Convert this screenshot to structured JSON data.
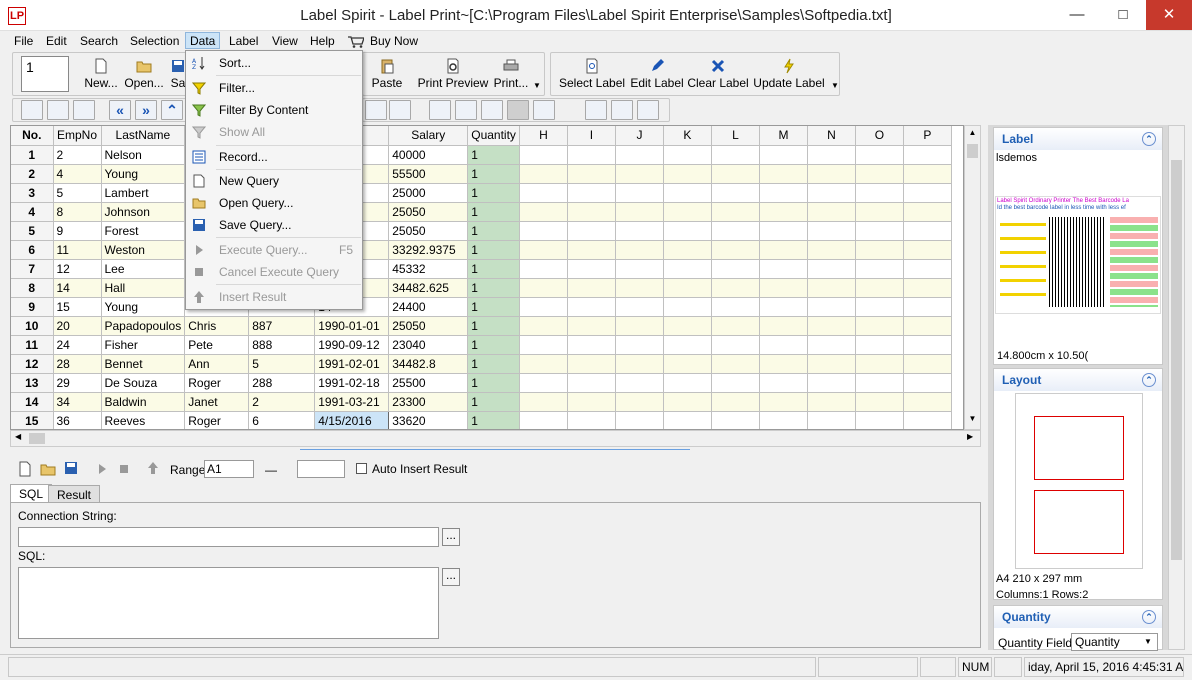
{
  "window": {
    "title": "Label Spirit - Label Print~[C:\\Program Files\\Label Spirit Enterprise\\Samples\\Softpedia.txt]",
    "icon_text": "LP"
  },
  "menu": [
    "File",
    "Edit",
    "Search",
    "Selection",
    "Data",
    "Label",
    "View",
    "Help",
    "Buy Now"
  ],
  "toolbar1": {
    "number_field": "1",
    "buttons": [
      "New...",
      "Open...",
      "Sa",
      "Paste",
      "Print Preview",
      "Print...",
      "Select Label",
      "Edit Label",
      "Clear Label",
      "Update Label"
    ]
  },
  "data_menu": {
    "items": [
      {
        "label": "Sort...",
        "enabled": true
      },
      {
        "label": "Filter...",
        "enabled": true
      },
      {
        "label": "Filter By Content",
        "enabled": true
      },
      {
        "label": "Show All",
        "enabled": false
      },
      {
        "label": "Record...",
        "enabled": true
      },
      {
        "label": "New Query",
        "enabled": true
      },
      {
        "label": "Open Query...",
        "enabled": true
      },
      {
        "label": "Save Query...",
        "enabled": true
      },
      {
        "label": "Execute Query...",
        "enabled": false,
        "shortcut": "F5"
      },
      {
        "label": "Cancel Execute Query",
        "enabled": false
      },
      {
        "label": "Insert Result",
        "enabled": false
      }
    ]
  },
  "grid": {
    "headers": [
      "No.",
      "EmpNo",
      "LastName",
      "",
      "",
      "e",
      "Salary",
      "Quantity",
      "H",
      "I",
      "J",
      "K",
      "L",
      "M",
      "N",
      "O",
      "P"
    ],
    "rows": [
      [
        "1",
        "2",
        "Nelson",
        "",
        "",
        "28",
        "40000",
        "1"
      ],
      [
        "2",
        "4",
        "Young",
        "",
        "",
        "28",
        "55500",
        "1"
      ],
      [
        "3",
        "5",
        "Lambert",
        "",
        "",
        "06",
        "25000",
        "1"
      ],
      [
        "4",
        "8",
        "Johnson",
        "",
        "",
        "05",
        "25050",
        "1"
      ],
      [
        "5",
        "9",
        "Forest",
        "",
        "",
        "17",
        "25050",
        "1"
      ],
      [
        "6",
        "11",
        "Weston",
        "",
        "",
        "17",
        "33292.9375",
        "1"
      ],
      [
        "7",
        "12",
        "Lee",
        "",
        "",
        "01",
        "45332",
        "1"
      ],
      [
        "8",
        "14",
        "Hall",
        "",
        "",
        "04",
        "34482.625",
        "1"
      ],
      [
        "9",
        "15",
        "Young",
        "",
        "",
        "14",
        "24400",
        "1"
      ],
      [
        "10",
        "20",
        "Papadopoulos",
        "Chris",
        "887",
        "1990-01-01",
        "25050",
        "1"
      ],
      [
        "11",
        "24",
        "Fisher",
        "Pete",
        "888",
        "1990-09-12",
        "23040",
        "1"
      ],
      [
        "12",
        "28",
        "Bennet",
        "Ann",
        "5",
        "1991-02-01",
        "34482.8",
        "1"
      ],
      [
        "13",
        "29",
        "De Souza",
        "Roger",
        "288",
        "1991-02-18",
        "25500",
        "1"
      ],
      [
        "14",
        "34",
        "Baldwin",
        "Janet",
        "2",
        "1991-03-21",
        "23300",
        "1"
      ],
      [
        "15",
        "36",
        "Reeves",
        "Roger",
        "6",
        "4/15/2016",
        "33620",
        "1"
      ]
    ]
  },
  "sql": {
    "range_label": "Range:",
    "range_value": "A1",
    "range_sep": "—",
    "auto_insert": "Auto Insert Result",
    "tabs": [
      "SQL",
      "Result"
    ],
    "connection_label": "Connection String:",
    "sql_label": "SQL:",
    "browse": "..."
  },
  "right": {
    "label_title": "Label",
    "label_name": "lsdemos",
    "label_size": "14.800cm x 10.50(",
    "preview_heading": "Label Spirit  Ordinary Printer  The Best Barcode La",
    "preview_sub": "Id the best barcode label in less time with less ef",
    "layout_title": "Layout",
    "paper": "A4 210 x 297 mm",
    "colrows": "Columns:1 Rows:2",
    "quantity_title": "Quantity",
    "quantity_field_label": "Quantity Field:",
    "quantity_field_value": "Quantity"
  },
  "status": {
    "num": "NUM",
    "datetime": "iday, April 15, 2016 4:45:31 A."
  }
}
